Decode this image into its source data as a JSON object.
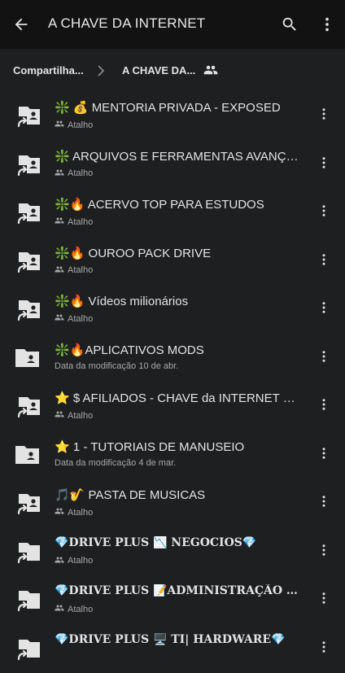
{
  "header": {
    "title": "A CHAVE DA INTERNET",
    "back_icon": "arrow-back-icon",
    "search_icon": "search-icon",
    "more_icon": "more-vert-icon"
  },
  "breadcrumb": {
    "parent": "Compartilha...",
    "current": "A CHAVE DA...",
    "shared_icon": "people-icon"
  },
  "items": [
    {
      "name": "❇️ 💰 MENTORIA PRIVADA - EXPOSED",
      "sub": "Atalho",
      "type": "shortcut",
      "style": "normal"
    },
    {
      "name": "❇️ ARQUIVOS E FERRAMENTAS AVANÇADAS",
      "sub": "Atalho",
      "type": "shortcut",
      "style": "normal"
    },
    {
      "name": "❇️🔥 ACERVO TOP PARA ESTUDOS",
      "sub": "Atalho",
      "type": "shortcut",
      "style": "normal"
    },
    {
      "name": "❇️🔥 OUROO PACK DRIVE",
      "sub": "Atalho",
      "type": "shortcut",
      "style": "normal"
    },
    {
      "name": "❇️🔥 Vídeos milionários",
      "sub": "Atalho",
      "type": "shortcut",
      "style": "normal"
    },
    {
      "name": "❇️🔥APLICATIVOS MODS",
      "sub": "Data da modificação  10 de abr.",
      "type": "folder",
      "style": "normal"
    },
    {
      "name": "⭐ $ AFILIADOS -  CHAVE da INTERNET EXPOSED",
      "sub": "Atalho",
      "type": "shortcut",
      "style": "normal"
    },
    {
      "name": "⭐ 1 - TUTORIAIS DE MANUSEIO",
      "sub": "Data da modificação  4 de mar.",
      "type": "folder",
      "style": "normal"
    },
    {
      "name": "🎵🎷 PASTA DE MUSICAS",
      "sub": "Atalho",
      "type": "shortcut",
      "style": "normal"
    },
    {
      "name": "💎DRIVE PLUS 📉 NEGOCIOS💎",
      "sub": "Atalho",
      "type": "shortcut-plain",
      "style": "bold"
    },
    {
      "name": "💎DRIVE PLUS 📝ADMINISTRAÇÃO   💎",
      "sub": "Atalho",
      "type": "shortcut-plain",
      "style": "bold"
    },
    {
      "name": "💎DRIVE PLUS 🖥️ TI| HARDWARE💎",
      "sub": "",
      "type": "shortcut-plain",
      "style": "bold"
    }
  ]
}
